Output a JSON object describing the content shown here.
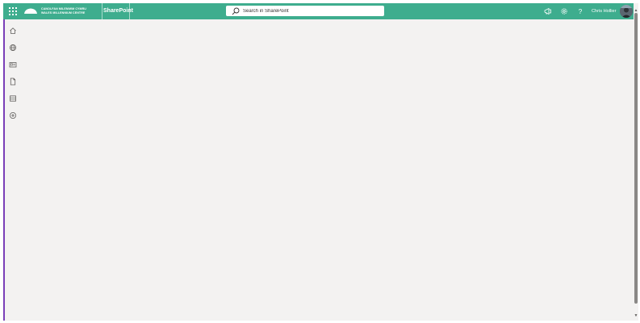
{
  "suitebar": {
    "logo_line1": "CANOLFAN MILENIWM CYMRU",
    "logo_line2": "WALES MILLENNIUM CENTRE",
    "app_name": "SharePoint",
    "user_name": "Chris Hollier"
  },
  "search": {
    "placeholder": "Search in SharePoint"
  },
  "icons": {
    "waffle": "app-launcher-icon",
    "megaphone": "megaphone-icon",
    "settings": "gear-icon",
    "help": "question-icon"
  },
  "left_rail": [
    {
      "icon": "home-icon"
    },
    {
      "icon": "globe-icon"
    },
    {
      "icon": "news-icon"
    },
    {
      "icon": "document-icon"
    },
    {
      "icon": "list-icon"
    },
    {
      "icon": "add-icon"
    }
  ],
  "colors": {
    "suitebar": "#3ead8e",
    "accent": "#7a3fb8",
    "canvas": "#f3f2f1"
  }
}
